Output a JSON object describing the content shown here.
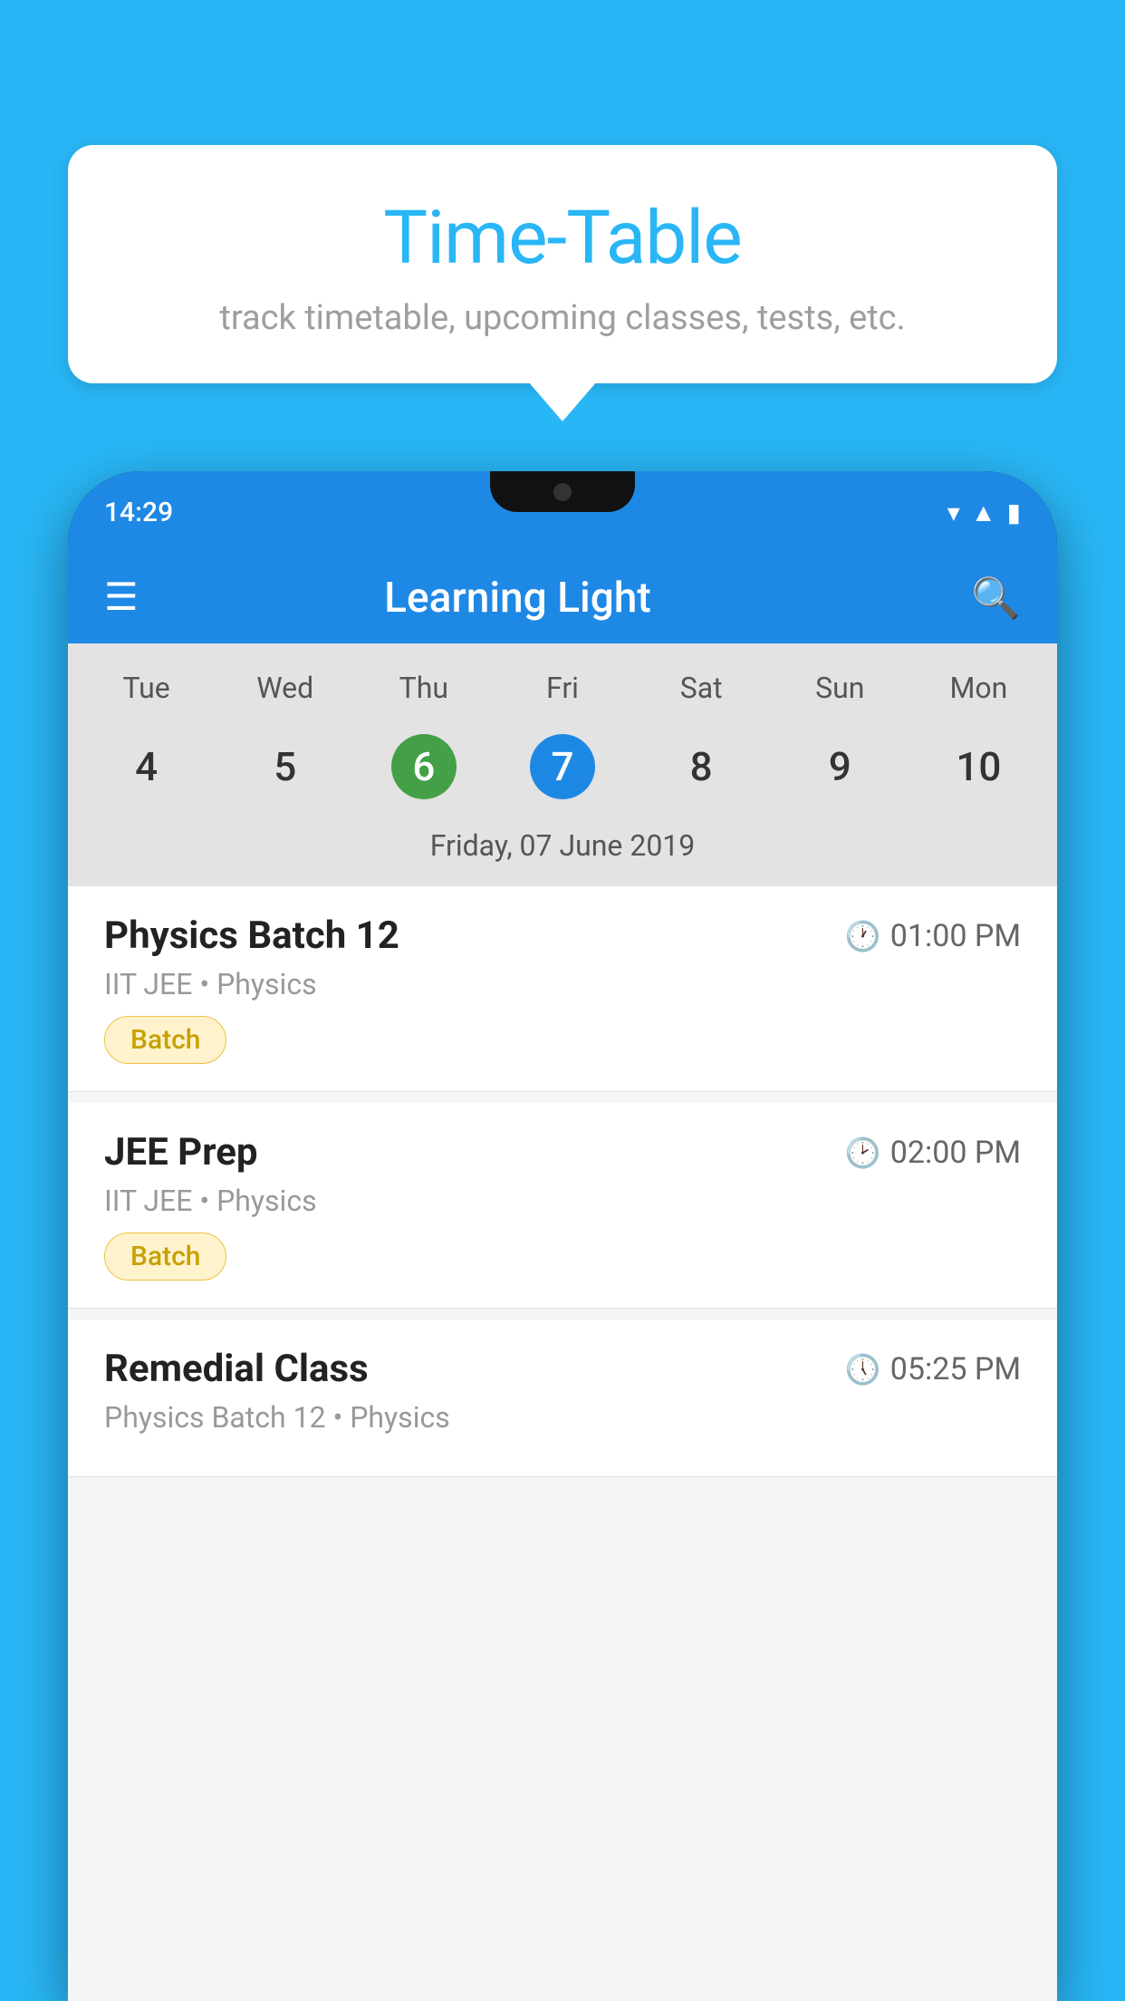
{
  "background_color": "#29B6F6",
  "tooltip": {
    "title": "Time-Table",
    "subtitle": "track timetable, upcoming classes, tests, etc."
  },
  "phone": {
    "status_bar": {
      "time": "14:29"
    },
    "app_header": {
      "title": "Learning Light"
    },
    "calendar": {
      "days": [
        "Tue",
        "Wed",
        "Thu",
        "Fri",
        "Sat",
        "Sun",
        "Mon"
      ],
      "dates": [
        "4",
        "5",
        "6",
        "7",
        "8",
        "9",
        "10"
      ],
      "today_index": 2,
      "selected_index": 3,
      "selected_date_label": "Friday, 07 June 2019"
    },
    "schedule": [
      {
        "name": "Physics Batch 12",
        "time": "01:00 PM",
        "meta": "IIT JEE • Physics",
        "badge": "Batch"
      },
      {
        "name": "JEE Prep",
        "time": "02:00 PM",
        "meta": "IIT JEE • Physics",
        "badge": "Batch"
      },
      {
        "name": "Remedial Class",
        "time": "05:25 PM",
        "meta": "Physics Batch 12 • Physics",
        "badge": ""
      }
    ]
  }
}
